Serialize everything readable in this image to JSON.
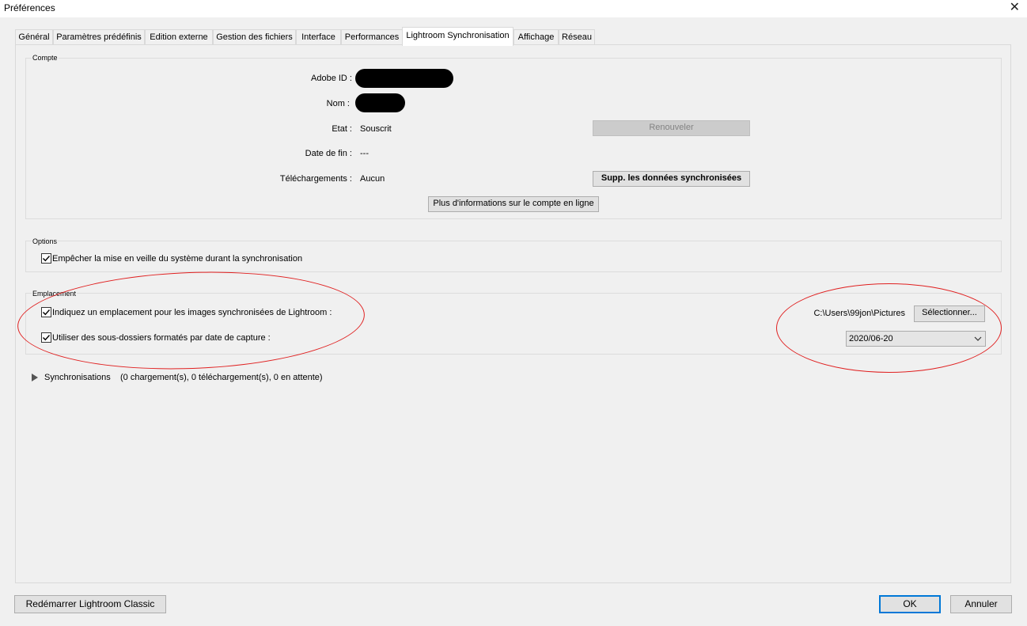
{
  "window": {
    "title": "Préférences",
    "close_glyph": "✕"
  },
  "tabs": [
    {
      "label": "Général"
    },
    {
      "label": "Paramètres prédéfinis"
    },
    {
      "label": "Edition externe"
    },
    {
      "label": "Gestion des fichiers"
    },
    {
      "label": "Interface"
    },
    {
      "label": "Performances"
    },
    {
      "label": "Lightroom Synchronisation",
      "active": true
    },
    {
      "label": "Affichage"
    },
    {
      "label": "Réseau"
    }
  ],
  "account": {
    "group_label": "Compte",
    "adobe_id_label": "Adobe ID :",
    "name_label": "Nom :",
    "state_label": "Etat :",
    "state_value": "Souscrit",
    "end_date_label": "Date de fin :",
    "end_date_value": "---",
    "downloads_label": "Téléchargements :",
    "downloads_value": "Aucun",
    "renew_button": "Renouveler",
    "delete_synced_button": "Supp. les données synchronisées",
    "more_info_button": "Plus d'informations sur le compte en ligne"
  },
  "options": {
    "group_label": "Options",
    "prevent_sleep_label": "Empêcher la mise en veille du système durant la synchronisation",
    "prevent_sleep_checked": true
  },
  "location": {
    "group_label": "Emplacement",
    "specify_location_label": "Indiquez un emplacement pour les images synchronisées de Lightroom :",
    "specify_location_checked": true,
    "subfolders_label": "Utiliser des sous-dossiers formatés par date de capture :",
    "subfolders_checked": true,
    "path": "C:\\Users\\99jon\\Pictures",
    "select_button": "Sélectionner...",
    "date_format": "2020/06-20"
  },
  "sync": {
    "label": "Synchronisations",
    "status": "(0 chargement(s), 0 téléchargement(s), 0 en attente)"
  },
  "footer": {
    "restart_button": "Redémarrer Lightroom Classic",
    "ok_button": "OK",
    "cancel_button": "Annuler"
  },
  "colors": {
    "annotation_red": "#e02020",
    "accent_blue": "#0078d7"
  }
}
